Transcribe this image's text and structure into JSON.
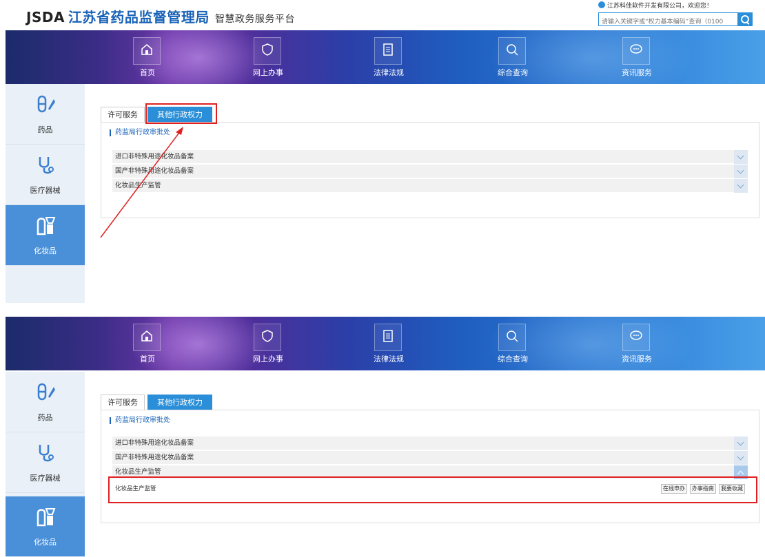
{
  "header": {
    "brand_en": "JSDA",
    "brand_cn": "江苏省药品监督管理局",
    "brand_sub": "智慧政务服务平台",
    "welcome": "江苏科佳软件开发有限公司，欢迎您！",
    "search_placeholder": "请输入关键字或“权力基本编码”查询（0100"
  },
  "nav": [
    {
      "label": "首页",
      "icon": "home-icon"
    },
    {
      "label": "网上办事",
      "icon": "shield-icon"
    },
    {
      "label": "法律法规",
      "icon": "document-icon"
    },
    {
      "label": "综合查询",
      "icon": "search-icon"
    },
    {
      "label": "资讯服务",
      "icon": "chat-icon"
    }
  ],
  "sidebar": [
    {
      "label": "药品",
      "icon": "pill-icon"
    },
    {
      "label": "医疗器械",
      "icon": "stethoscope-icon"
    },
    {
      "label": "化妆品",
      "icon": "cosmetics-icon"
    }
  ],
  "tabs": [
    "许可服务",
    "其他行政权力"
  ],
  "section_title": "药监局行政审批处",
  "rows": [
    "进口非特殊用途化妆品备案",
    "国产非特殊用途化妆品备案",
    "化妆品生产监管"
  ],
  "detail": {
    "label": "化妆品生产监管",
    "buttons": [
      "在线申办",
      "办事指南",
      "我要收藏"
    ]
  },
  "colors": {
    "accent": "#2a8fd8",
    "highlight": "#e02020",
    "sidebar_active": "#4a90d9"
  }
}
